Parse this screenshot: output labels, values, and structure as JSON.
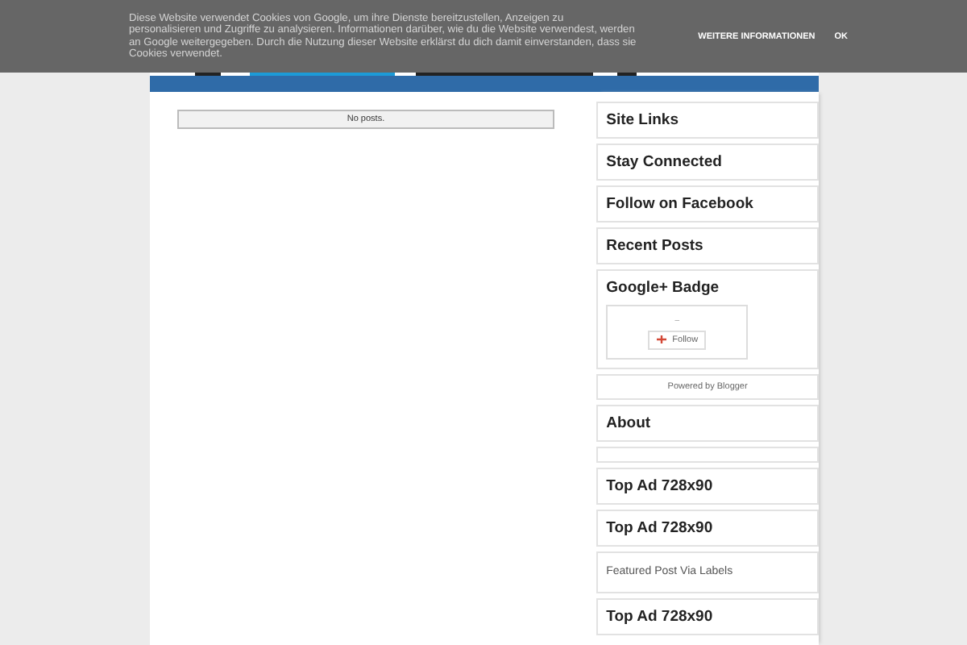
{
  "cookie_banner": {
    "message": "Diese Website verwendet Cookies von Google, um ihre Dienste bereitzustellen, Anzeigen zu personalisieren und Zugriffe zu analysieren. Informationen darüber, wie du die Website verwendest, werden an Google weitergegeben. Durch die Nutzung dieser Website erklärst du dich damit einverstanden, dass sie Cookies verwendet.",
    "buttons": [
      "WEITERE INFORMATIONEN",
      "OK"
    ]
  },
  "main": {
    "notice": "No posts."
  },
  "sidebar": [
    {
      "kind": "title",
      "title": "Site Links"
    },
    {
      "kind": "title",
      "title": "Stay Connected"
    },
    {
      "kind": "title",
      "title": "Follow on Facebook"
    },
    {
      "kind": "title",
      "title": "Recent Posts"
    },
    {
      "kind": "badge",
      "title": "Google+ Badge",
      "dash": "–",
      "button": "Follow"
    },
    {
      "kind": "footer",
      "text": "Powered by Blogger"
    },
    {
      "kind": "title",
      "title": "About"
    },
    {
      "kind": "empty"
    },
    {
      "kind": "title",
      "title": "Top Ad 728x90"
    },
    {
      "kind": "title",
      "title": "Top Ad 728x90"
    },
    {
      "kind": "subtle",
      "title": "Featured Post Via Labels"
    },
    {
      "kind": "title",
      "title": "Top Ad 728x90"
    }
  ]
}
